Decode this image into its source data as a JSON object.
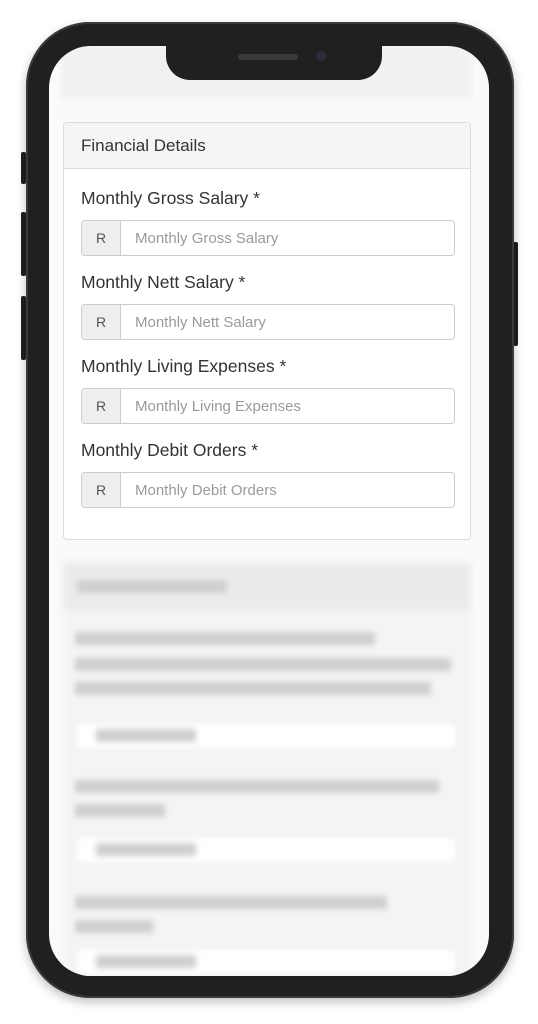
{
  "card": {
    "title": "Financial Details",
    "fields": [
      {
        "label": "Monthly Gross Salary *",
        "prefix": "R",
        "placeholder": "Monthly Gross Salary",
        "value": ""
      },
      {
        "label": "Monthly Nett Salary *",
        "prefix": "R",
        "placeholder": "Monthly Nett Salary",
        "value": ""
      },
      {
        "label": "Monthly Living Expenses *",
        "prefix": "R",
        "placeholder": "Monthly Living Expenses",
        "value": ""
      },
      {
        "label": "Monthly Debit Orders *",
        "prefix": "R",
        "placeholder": "Monthly Debit Orders",
        "value": ""
      }
    ]
  },
  "colors": {
    "phone_frame": "#202020",
    "card_header_bg": "#f5f5f5",
    "addon_bg": "#eeeeee",
    "border": "#cccccc"
  }
}
